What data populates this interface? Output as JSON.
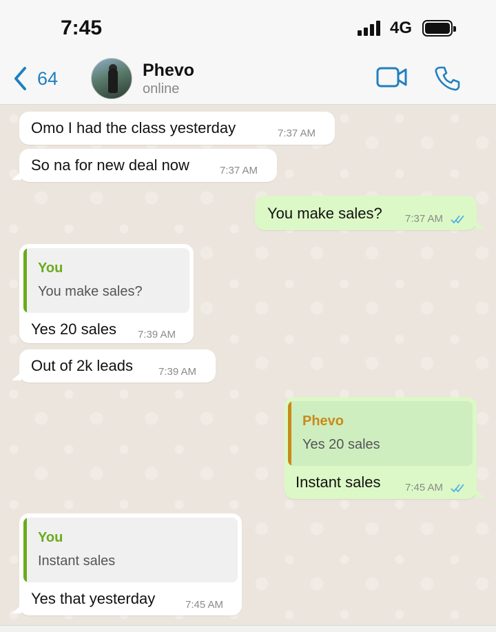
{
  "status_bar": {
    "time": "7:45",
    "network": "4G"
  },
  "header": {
    "back_count": "64",
    "contact_name": "Phevo",
    "contact_status": "online"
  },
  "colors": {
    "accent": "#1f7fc0",
    "outgoing_bubble": "#dcf8c6",
    "incoming_bubble": "#ffffff",
    "quote_you_green": "#6aab1d",
    "quote_phevo_orange": "#c98a1a",
    "read_ticks": "#4fb0e8"
  },
  "messages": [
    {
      "direction": "in",
      "text": "Omo I had the class yesterday",
      "time": "7:37 AM"
    },
    {
      "direction": "in",
      "text": "So na for new deal now",
      "time": "7:37 AM"
    },
    {
      "direction": "out",
      "text": "You make sales?",
      "time": "7:37 AM",
      "status": "read"
    },
    {
      "direction": "in",
      "quote": {
        "author": "You",
        "text": "You make sales?"
      },
      "text": "Yes 20 sales",
      "time": "7:39 AM"
    },
    {
      "direction": "in",
      "text": "Out of 2k leads",
      "time": "7:39 AM"
    },
    {
      "direction": "out",
      "quote": {
        "author": "Phevo",
        "text": "Yes 20 sales"
      },
      "text": "Instant sales",
      "time": "7:45 AM",
      "status": "read"
    },
    {
      "direction": "in",
      "quote": {
        "author": "You",
        "text": "Instant sales"
      },
      "text": "Yes that yesterday",
      "time": "7:45 AM"
    }
  ]
}
